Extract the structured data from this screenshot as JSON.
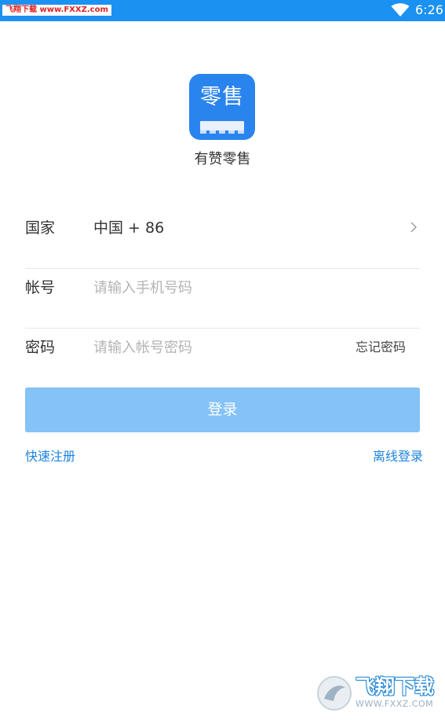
{
  "status_bar": {
    "watermark": "飞翔下载 www.FXXZ.com",
    "time": "6:26",
    "wifi_icon": "wifi-icon"
  },
  "app": {
    "logo_text": "零售",
    "name": "有赞零售"
  },
  "form": {
    "country": {
      "label": "国家",
      "value": "中国 + 86",
      "icon": "chevron-right-icon"
    },
    "account": {
      "label": "帐号",
      "value": "",
      "placeholder": "请输入手机号码"
    },
    "password": {
      "label": "密码",
      "value": "",
      "placeholder": "请输入帐号密码",
      "forgot_label": "忘记密码"
    }
  },
  "login_button_label": "登录",
  "links": {
    "register": "快速注册",
    "offline_login": "离线登录"
  },
  "corner_watermark": {
    "title": "飞翔下载",
    "subtitle": "WWW.FXXZ.COM"
  },
  "colors": {
    "status_bar": "#1b91f2",
    "logo_bg": "#2a84ee",
    "button_bg": "#84c2f7",
    "link": "#1d83e0"
  }
}
